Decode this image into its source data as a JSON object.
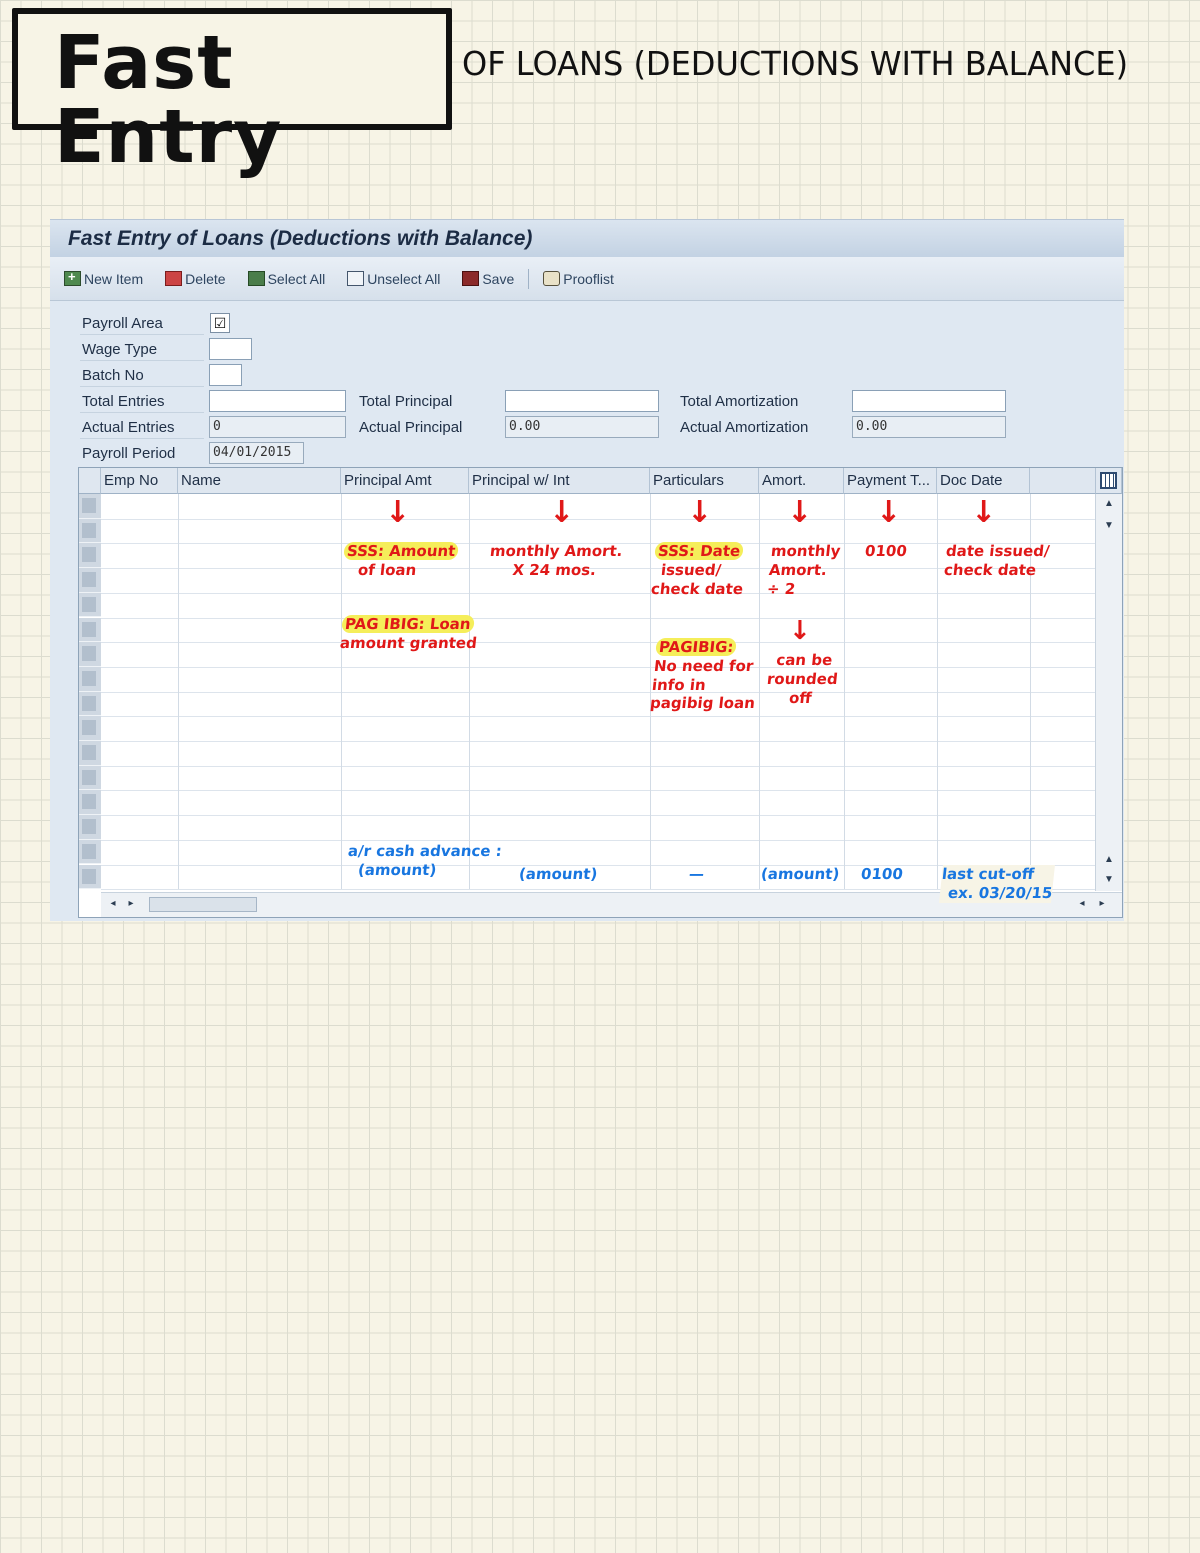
{
  "heading": {
    "title": "Fast Entry",
    "subtitle": "OF LOANS (DEDUCTIONS WITH BALANCE)"
  },
  "window": {
    "title": "Fast Entry of Loans (Deductions with Balance)"
  },
  "toolbar": {
    "new_item": "New Item",
    "delete": "Delete",
    "select_all": "Select All",
    "unselect_all": "Unselect All",
    "save": "Save",
    "prooflist": "Prooflist"
  },
  "form": {
    "payroll_area_label": "Payroll Area",
    "payroll_area_checked": "☑",
    "wage_type_label": "Wage Type",
    "batch_no_label": "Batch No",
    "total_entries_label": "Total Entries",
    "actual_entries_label": "Actual Entries",
    "actual_entries_value": "0",
    "payroll_period_label": "Payroll Period",
    "payroll_period_value": "04/01/2015",
    "total_principal_label": "Total Principal",
    "actual_principal_label": "Actual Principal",
    "actual_principal_value": "0.00",
    "total_amortization_label": "Total Amortization",
    "actual_amortization_label": "Actual Amortization",
    "actual_amortization_value": "0.00"
  },
  "table": {
    "columns": [
      "Emp No",
      "Name",
      "Principal Amt",
      "Principal w/ Int",
      "Particulars",
      "Amort.",
      "Payment T...",
      "Doc Date"
    ]
  },
  "notes": {
    "principal_sss": [
      "SSS: Amount",
      "of loan"
    ],
    "principal_pagibig": [
      "PAG IBIG: Loan",
      "amount granted"
    ],
    "principal_int": [
      "monthly Amort.",
      "X 24 mos."
    ],
    "particulars_sss": [
      "SSS: Date",
      "issued/",
      "check date"
    ],
    "particulars_pagibig": [
      "PAGIBIG:",
      "No need for",
      "info in",
      "pagibig loan"
    ],
    "amort": [
      "monthly",
      "Amort.",
      "÷ 2"
    ],
    "amort_round": [
      "can be",
      "rounded",
      "off"
    ],
    "payment": "0100",
    "docdate": [
      "date issued/",
      "check date"
    ],
    "cash_advance_label": "a/r cash advance :",
    "cash_advance": {
      "principal": "(amount)",
      "principal_int": "(amount)",
      "particulars": "—",
      "amort": "(amount)",
      "payment": "0100",
      "docdate": [
        "last cut-off",
        "ex. 03/20/15"
      ]
    }
  }
}
